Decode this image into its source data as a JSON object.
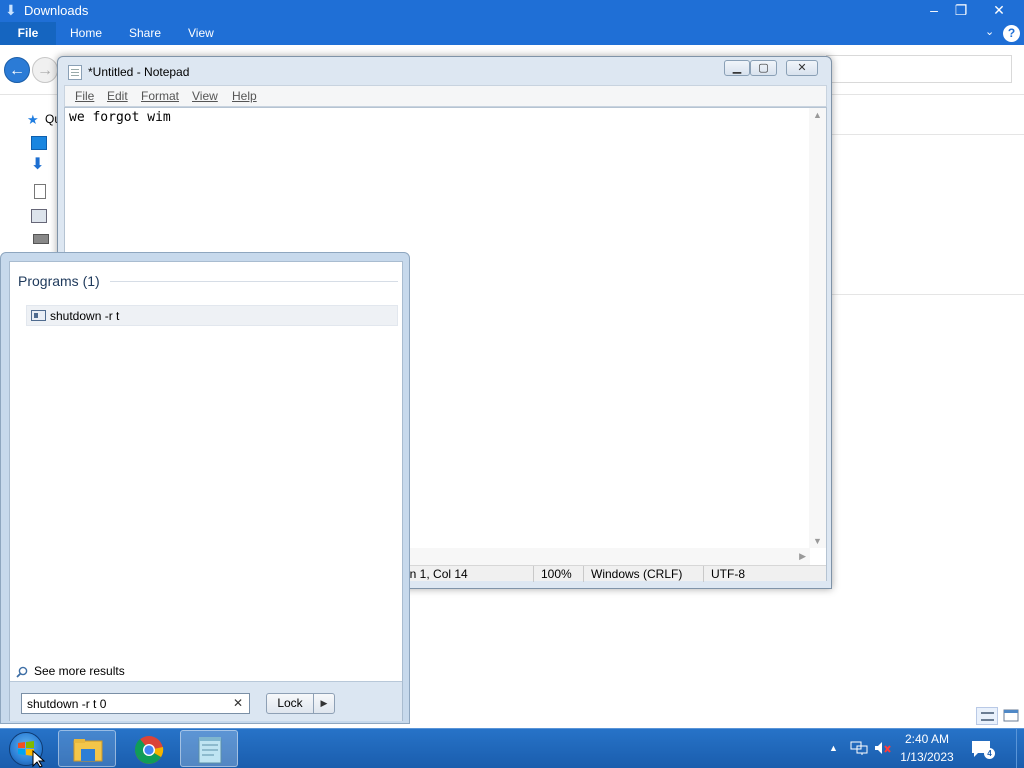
{
  "explorer": {
    "title": "Downloads",
    "ribbon_tabs": [
      "File",
      "Home",
      "Share",
      "View"
    ],
    "sidebar_label": "Qu",
    "controls": {
      "minimize": "–",
      "maximize": "❐",
      "close": "✕"
    }
  },
  "notepad": {
    "title": "*Untitled - Notepad",
    "menu": [
      "File",
      "Edit",
      "Format",
      "View",
      "Help"
    ],
    "text": "we forgot wim",
    "status": {
      "position": "Ln 1, Col 14",
      "zoom": "100%",
      "line_ending": "Windows (CRLF)",
      "encoding": "UTF-8"
    }
  },
  "start_menu": {
    "section_title": "Programs (1)",
    "result_label": "shutdown -r t",
    "see_more": "See more results",
    "search_value": "shutdown -r t 0",
    "power_button": "Lock"
  },
  "taskbar": {
    "time": "2:40 AM",
    "date": "1/13/2023",
    "notification_count": "4",
    "pinned": [
      "file-explorer",
      "chrome",
      "notepad"
    ]
  },
  "colors": {
    "taskbar": "#1a5dad",
    "explorer_title": "#1f6fd6",
    "window_frame": "#dde7f2"
  }
}
